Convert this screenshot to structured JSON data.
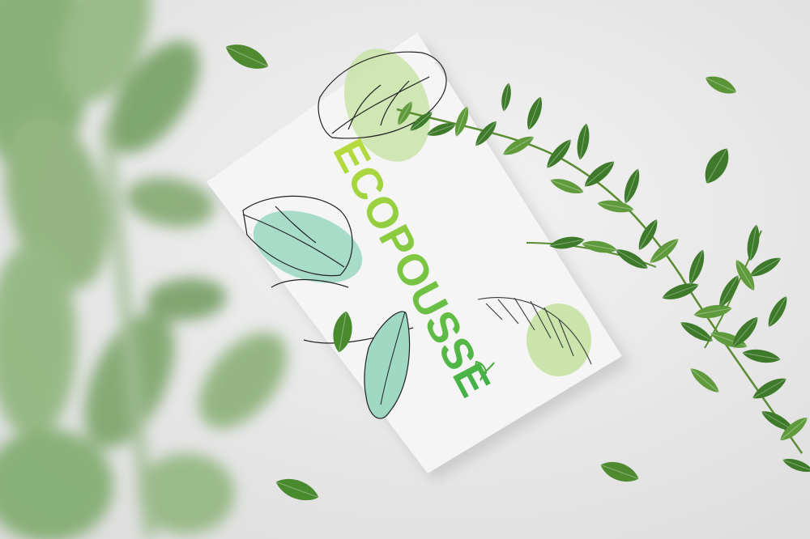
{
  "poster": {
    "brand_name": "ECOPOUSSE"
  },
  "colors": {
    "background": "#e9e9e9",
    "paper": "#f4f5f4",
    "brand_gradient_start": "#b9dc3e",
    "brand_gradient_end": "#3fb047",
    "mint_leaf": "#9fd9c4",
    "lime_blob": "#c7e2a4",
    "foliage_dark": "#3d7a2a",
    "foliage_mid": "#5f9a3c",
    "foliage_blur": "#7aa868"
  }
}
